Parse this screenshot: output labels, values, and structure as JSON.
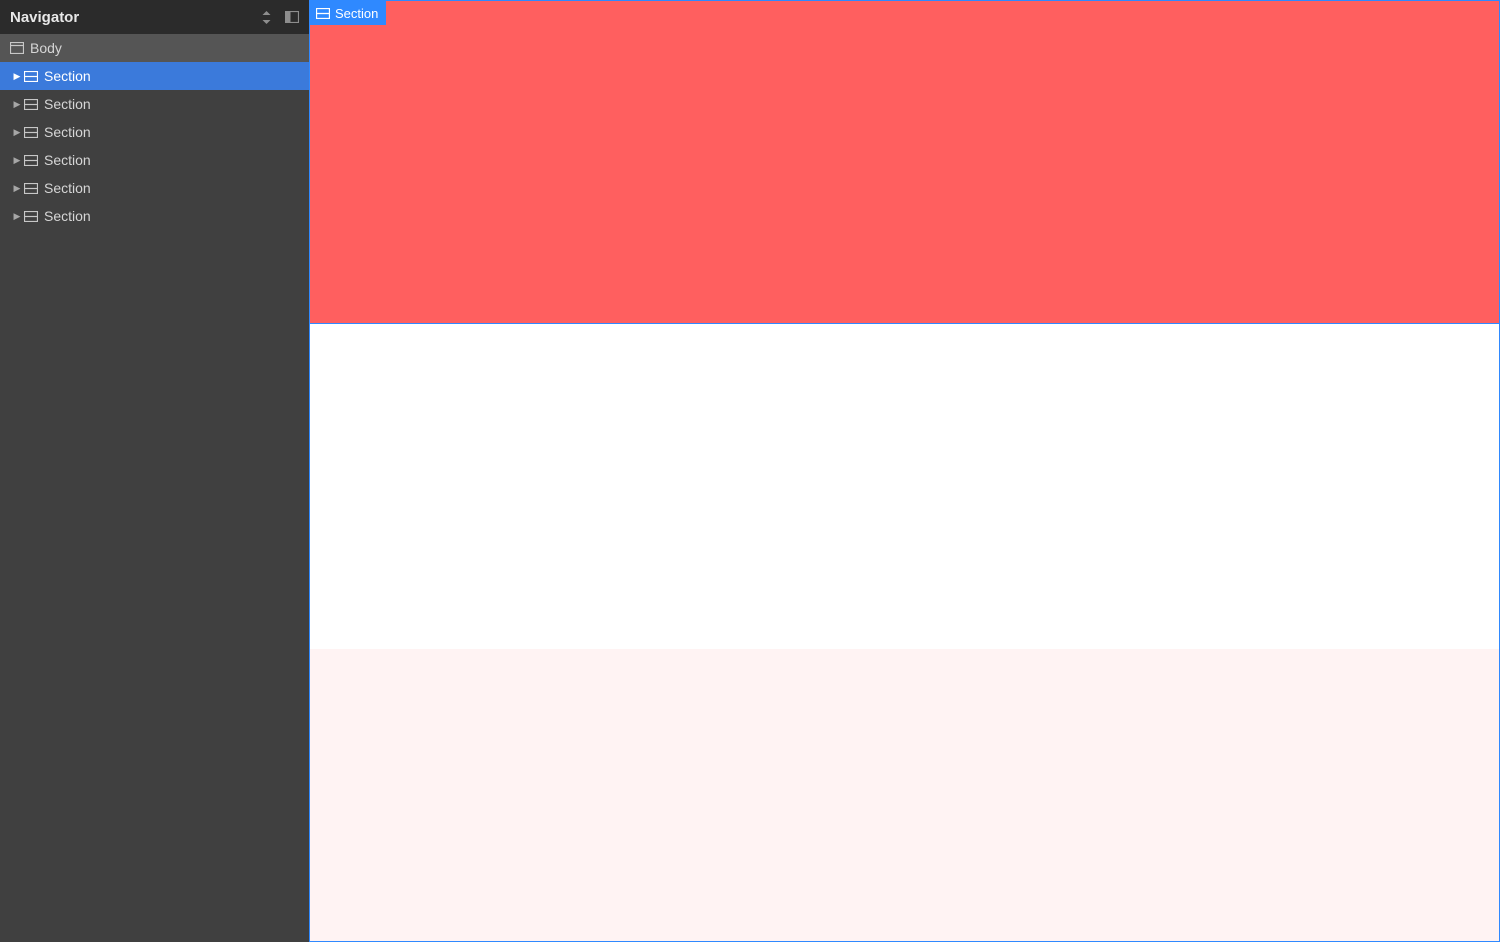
{
  "navigator": {
    "title": "Navigator",
    "body_label": "Body",
    "sections": [
      {
        "label": "Section",
        "selected": true
      },
      {
        "label": "Section",
        "selected": false
      },
      {
        "label": "Section",
        "selected": false
      },
      {
        "label": "Section",
        "selected": false
      },
      {
        "label": "Section",
        "selected": false
      },
      {
        "label": "Section",
        "selected": false
      }
    ]
  },
  "canvas": {
    "selected_label": "Section",
    "section_colors": [
      "#ff5f5f",
      "#ffffff",
      "#fff3f3"
    ]
  }
}
